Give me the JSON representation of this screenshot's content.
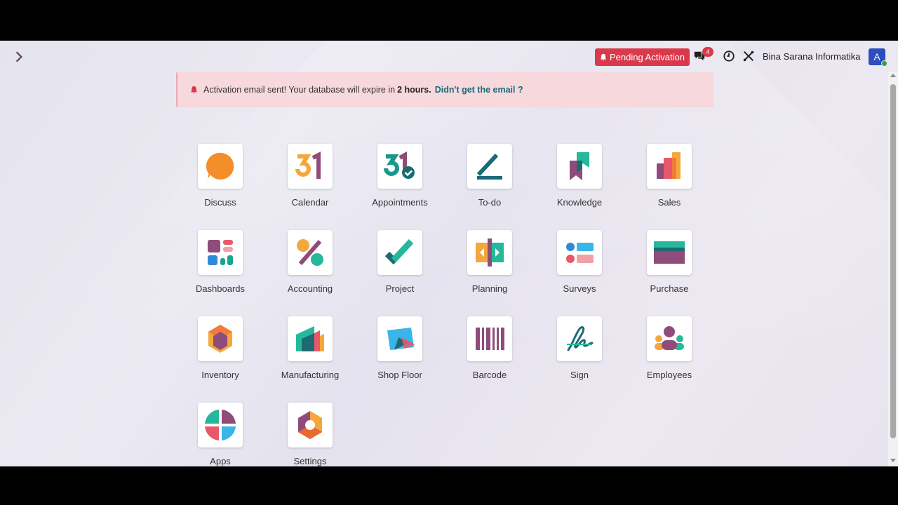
{
  "header": {
    "pending_label": "Pending Activation",
    "messages_count": "4",
    "company": "Bina Sarana Informatika",
    "avatar_letter": "A"
  },
  "alert": {
    "text": "Activation email sent! Your database will expire in",
    "bold": "2 hours.",
    "link": "Didn't get the email ?"
  },
  "apps": [
    {
      "label": "Discuss",
      "icon": "discuss-icon"
    },
    {
      "label": "Calendar",
      "icon": "calendar-icon"
    },
    {
      "label": "Appointments",
      "icon": "appointments-icon"
    },
    {
      "label": "To-do",
      "icon": "todo-icon"
    },
    {
      "label": "Knowledge",
      "icon": "knowledge-icon"
    },
    {
      "label": "Sales",
      "icon": "sales-icon"
    },
    {
      "label": "Dashboards",
      "icon": "dashboards-icon"
    },
    {
      "label": "Accounting",
      "icon": "accounting-icon"
    },
    {
      "label": "Project",
      "icon": "project-icon"
    },
    {
      "label": "Planning",
      "icon": "planning-icon"
    },
    {
      "label": "Surveys",
      "icon": "surveys-icon"
    },
    {
      "label": "Purchase",
      "icon": "purchase-icon"
    },
    {
      "label": "Inventory",
      "icon": "inventory-icon"
    },
    {
      "label": "Manufacturing",
      "icon": "manufacturing-icon"
    },
    {
      "label": "Shop Floor",
      "icon": "shop-floor-icon"
    },
    {
      "label": "Barcode",
      "icon": "barcode-icon"
    },
    {
      "label": "Sign",
      "icon": "sign-icon"
    },
    {
      "label": "Employees",
      "icon": "employees-icon"
    },
    {
      "label": "Apps",
      "icon": "apps-icon"
    },
    {
      "label": "Settings",
      "icon": "settings-icon"
    }
  ],
  "colors": {
    "accent_red": "#d9394a",
    "avatar_blue": "#2d4cc0",
    "link_teal": "#1a6b7a"
  }
}
